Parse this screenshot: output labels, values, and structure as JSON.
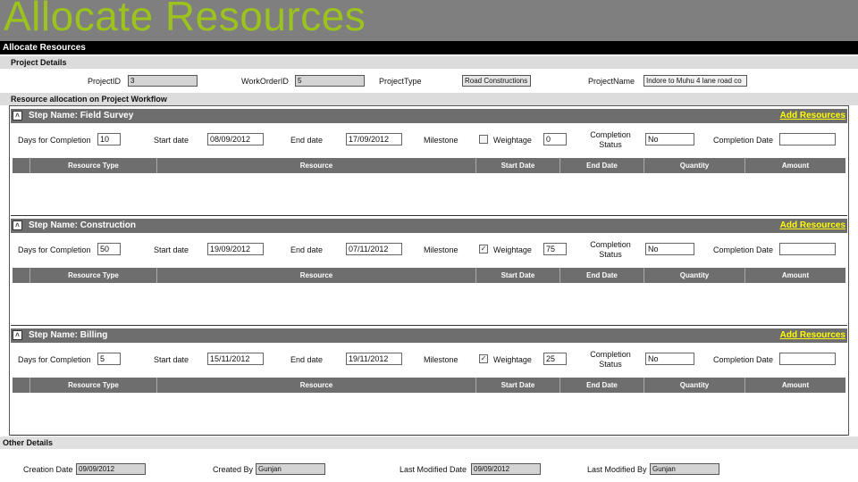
{
  "slide_title": "Allocate Resources",
  "app_header": "Allocate Resources",
  "project_details": {
    "section_label": "Project Details",
    "project_id_label": "ProjectID",
    "project_id": "3",
    "work_order_id_label": "WorkOrderID",
    "work_order_id": "5",
    "project_type_label": "ProjectType",
    "project_type": "Road Constructions",
    "project_name_label": "ProjectName",
    "project_name": "Indore to Muhu 4 lane road co"
  },
  "workflow": {
    "section_label": "Resource allocation on Project Workflow",
    "add_resources_label": "Add Resources",
    "labels": {
      "days": "Days for Completion",
      "start_date": "Start date",
      "end_date": "End date",
      "milestone": "Milestone",
      "weightage": "Weightage",
      "completion_status": "Completion Status",
      "completion_date": "Completion Date"
    },
    "columns": [
      "",
      "Resource Type",
      "Resource",
      "Start Date",
      "End Date",
      "Quantity",
      "Amount"
    ],
    "steps": [
      {
        "name": "Step Name: Field Survey",
        "days": "10",
        "start": "08/09/2012",
        "end": "17/09/2012",
        "milestone": false,
        "weightage": "0",
        "status": "No",
        "completion_date": ""
      },
      {
        "name": "Step Name: Construction",
        "days": "50",
        "start": "19/09/2012",
        "end": "07/11/2012",
        "milestone": true,
        "weightage": "75",
        "status": "No",
        "completion_date": ""
      },
      {
        "name": "Step Name: Billing",
        "days": "5",
        "start": "15/11/2012",
        "end": "19/11/2012",
        "milestone": true,
        "weightage": "25",
        "status": "No",
        "completion_date": ""
      }
    ]
  },
  "other_details": {
    "section_label": "Other Details",
    "creation_date_label": "Creation Date",
    "creation_date": "09/09/2012",
    "created_by_label": "Created By",
    "created_by": "Gunjan",
    "last_modified_date_label": "Last Modified Date",
    "last_modified_date": "09/09/2012",
    "last_modified_by_label": "Last Modified By",
    "last_modified_by": "Gunjan"
  }
}
